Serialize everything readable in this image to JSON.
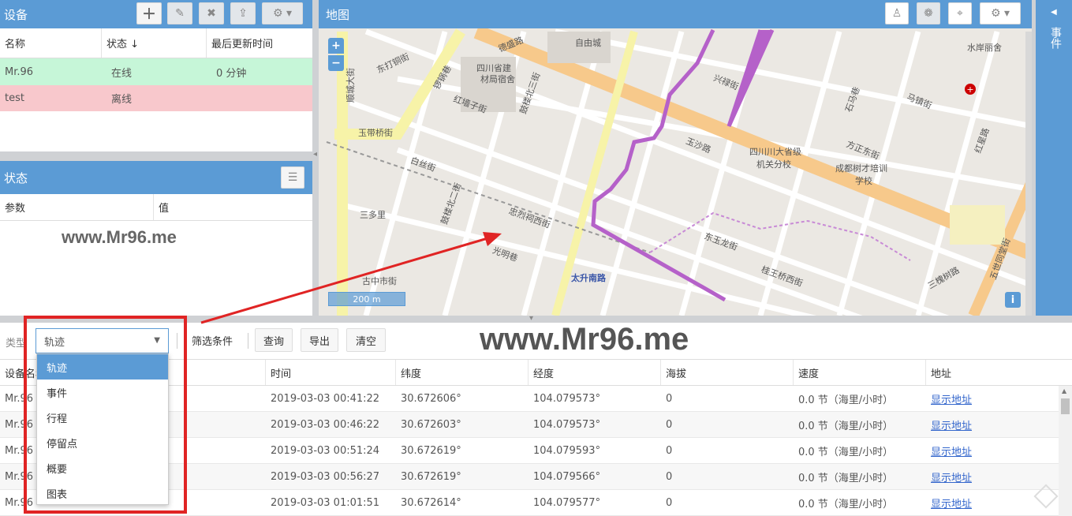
{
  "devices": {
    "title": "设备",
    "columns": [
      "名称",
      "状态 ↓",
      "最后更新时间"
    ],
    "rows": [
      {
        "name": "Mr.96",
        "status": "在线",
        "updated": "0 分钟"
      },
      {
        "name": "test",
        "status": "离线",
        "updated": ""
      }
    ]
  },
  "state": {
    "title": "状态",
    "columns": [
      "参数",
      "值"
    ]
  },
  "map": {
    "title": "地图",
    "labels": [
      "德盛路",
      "自由城",
      "四川省建",
      "材局宿舍",
      "东打铜街",
      "锣锅巷",
      "红墙子街",
      "鼓楼北三街",
      "玉带桥街",
      "顺城大街",
      "玉沙路",
      "四川川大省级",
      "机关分校",
      "成都树才培训",
      "学校",
      "方正东街",
      "马镇街",
      "石马巷",
      "白丝街",
      "忠烈祠西街",
      "鼓楼北二街",
      "光明巷",
      "三多里",
      "古中市街",
      "太升南路",
      "东玉龙街",
      "桂王桥西街",
      "三槐树路",
      "红星路",
      "水岸丽舍",
      "五世同堂街",
      "兴禄街"
    ],
    "scale": "200 m",
    "zoom_in": "+",
    "zoom_out": "−",
    "info": "i"
  },
  "side": {
    "label": "事件"
  },
  "watermark": "www.Mr96.me",
  "toolbar": {
    "type_label": "类型",
    "type_value": "轨迹",
    "filter": "筛选条件",
    "query": "查询",
    "export": "导出",
    "clear": "清空"
  },
  "dropdown": [
    "轨迹",
    "事件",
    "行程",
    "停留点",
    "概要",
    "图表"
  ],
  "table": {
    "columns": [
      "设备名称",
      "时间",
      "纬度",
      "经度",
      "海拔",
      "速度",
      "地址"
    ],
    "rows": [
      {
        "device": "Mr.96",
        "time": "2019-03-03 00:41:22",
        "lat": "30.672606°",
        "lon": "104.079573°",
        "alt": "0",
        "speed": "0.0 节（海里/小时）",
        "addr": "显示地址"
      },
      {
        "device": "Mr.96",
        "time": "2019-03-03 00:46:22",
        "lat": "30.672603°",
        "lon": "104.079573°",
        "alt": "0",
        "speed": "0.0 节（海里/小时）",
        "addr": "显示地址"
      },
      {
        "device": "Mr.96",
        "time": "2019-03-03 00:51:24",
        "lat": "30.672619°",
        "lon": "104.079593°",
        "alt": "0",
        "speed": "0.0 节（海里/小时）",
        "addr": "显示地址"
      },
      {
        "device": "Mr.96",
        "time": "2019-03-03 00:56:27",
        "lat": "30.672619°",
        "lon": "104.079566°",
        "alt": "0",
        "speed": "0.0 节（海里/小时）",
        "addr": "显示地址"
      },
      {
        "device": "Mr.96",
        "time": "2019-03-03 01:01:51",
        "lat": "30.672614°",
        "lon": "104.079577°",
        "alt": "0",
        "speed": "0.0 节（海里/小时）",
        "addr": "显示地址"
      }
    ]
  },
  "colors": {
    "header": "#5b9bd5",
    "online": "#c6f6d8",
    "offline": "#f8c8cc",
    "track": "#b561c9",
    "highlight": "#e02424"
  }
}
